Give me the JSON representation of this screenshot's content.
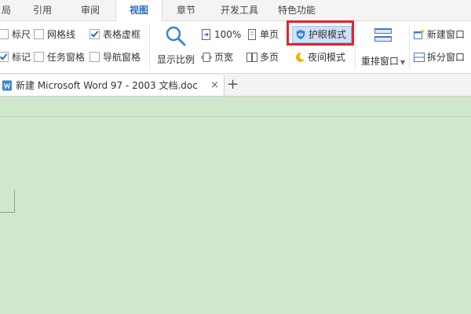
{
  "menubar": {
    "tabs": [
      {
        "label": "局",
        "name": "tab-layout"
      },
      {
        "label": "引用",
        "name": "tab-references"
      },
      {
        "label": "审阅",
        "name": "tab-review"
      },
      {
        "label": "视图",
        "name": "tab-view",
        "active": true
      },
      {
        "label": "章节",
        "name": "tab-chapter"
      },
      {
        "label": "开发工具",
        "name": "tab-developer"
      },
      {
        "label": "特色功能",
        "name": "tab-features"
      }
    ]
  },
  "ribbon": {
    "checkboxes": {
      "ruler": {
        "label": "标尺",
        "checked": false
      },
      "gridlines": {
        "label": "网格线",
        "checked": false
      },
      "table_gridlines": {
        "label": "表格虚框",
        "checked": true
      },
      "marks": {
        "label": "标记",
        "checked": true
      },
      "task_pane": {
        "label": "任务窗格",
        "checked": false
      },
      "nav_pane": {
        "label": "导航窗格",
        "checked": false
      }
    },
    "display_ratio_label": "显示比例",
    "zoom_100_label": "100%",
    "single_page_label": "单页",
    "page_width_label": "页宽",
    "multi_page_label": "多页",
    "eye_care_label": "护眼模式",
    "night_mode_label": "夜间模式",
    "rearrange_label": "重排窗口",
    "new_window_label": "新建窗口",
    "split_window_label": "拆分窗口"
  },
  "tabbar": {
    "doc_title": "新建 Microsoft Word 97 - 2003 文档.doc",
    "close_glyph": "×",
    "new_tab_glyph": "+"
  },
  "colors": {
    "accent": "#2b6ac3",
    "eye_care_background": "#cfe8cc",
    "highlight": "#e8212a"
  }
}
